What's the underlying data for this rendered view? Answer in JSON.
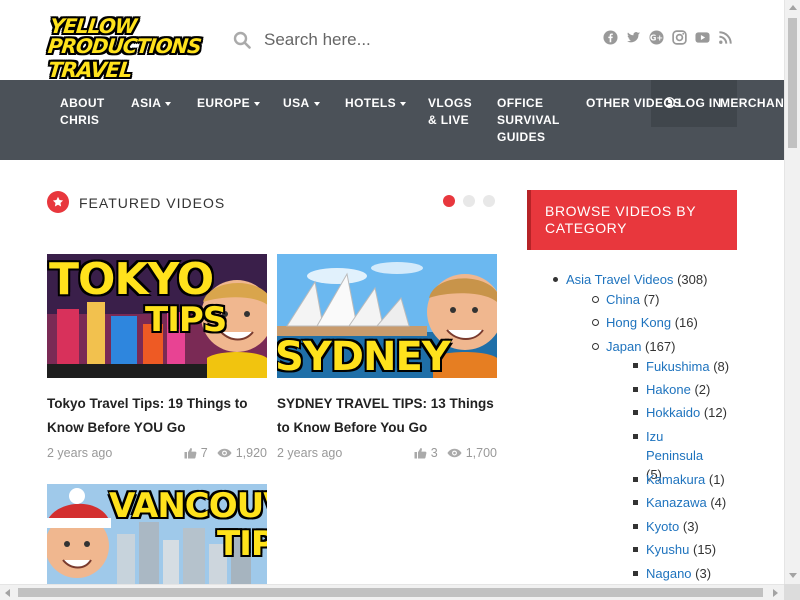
{
  "logo": {
    "line1": "YELLOW PRODUCTIONS",
    "line2": "TRAVEL VIDEOS"
  },
  "search": {
    "placeholder": "Search here..."
  },
  "social": [
    "facebook-icon",
    "twitter-icon",
    "google-plus-icon",
    "instagram-icon",
    "youtube-icon",
    "rss-icon"
  ],
  "nav": {
    "about": "ABOUT\nCHRIS",
    "asia": "ASIA",
    "europe": "EUROPE",
    "usa": "USA",
    "hotels": "HOTELS",
    "vlogs": "VLOGS\n& LIVE",
    "office": "OFFICE\nSURVIVAL\nGUIDES",
    "other": "OTHER VIDEOS",
    "login": "LOG IN",
    "merch": "MERCHANDISE"
  },
  "featured": {
    "title": "FEATURED VIDEOS",
    "cards": [
      {
        "thumb_text": "TOKYO TIPS",
        "title": "Tokyo Travel Tips: 19 Things to Know Before YOU Go",
        "ago": "2 years ago",
        "likes": "7",
        "views": "1,920"
      },
      {
        "thumb_text": "SYDNEY",
        "title": "SYDNEY TRAVEL TIPS: 13 Things to Know Before You Go",
        "ago": "2 years ago",
        "likes": "3",
        "views": "1,700"
      },
      {
        "thumb_text": "VANCOUVER TIPS",
        "title": "",
        "ago": "",
        "likes": "",
        "views": ""
      }
    ]
  },
  "sidebar": {
    "title": "BROWSE VIDEOS BY CATEGORY",
    "categories": [
      {
        "name": "Asia Travel Videos",
        "count": "(308)"
      },
      {
        "name": "China",
        "count": "(7)"
      },
      {
        "name": "Hong Kong",
        "count": "(16)"
      },
      {
        "name": "Japan",
        "count": "(167)"
      },
      {
        "name": "Fukushima",
        "count": "(8)"
      },
      {
        "name": "Hakone",
        "count": "(2)"
      },
      {
        "name": "Hokkaido",
        "count": "(12)"
      },
      {
        "name": "Izu Peninsula",
        "count": "(5)"
      },
      {
        "name": "Kamakura",
        "count": "(1)"
      },
      {
        "name": "Kanazawa",
        "count": "(4)"
      },
      {
        "name": "Kyoto",
        "count": "(3)"
      },
      {
        "name": "Kyushu",
        "count": "(15)"
      },
      {
        "name": "Nagano",
        "count": "(3)"
      }
    ]
  },
  "colors": {
    "accent": "#e8373d",
    "nav_bg": "#4b5158",
    "link": "#1e73be",
    "logo_yellow": "#ffe21c"
  }
}
